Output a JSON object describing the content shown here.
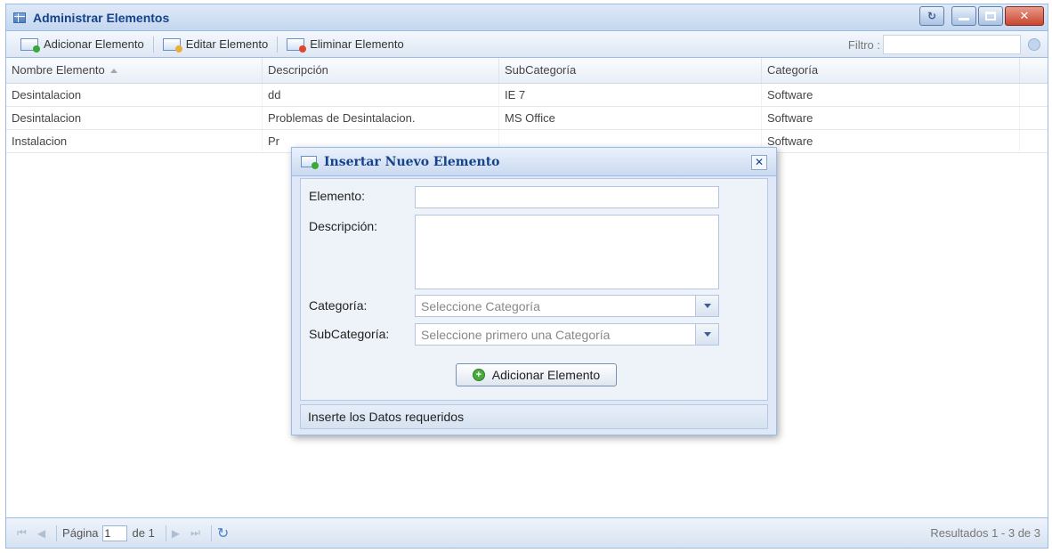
{
  "window": {
    "title": "Administrar Elementos"
  },
  "toolbar": {
    "add_label": "Adicionar Elemento",
    "edit_label": "Editar Elemento",
    "delete_label": "Eliminar Elemento",
    "filter_label": "Filtro :",
    "filter_value": ""
  },
  "grid": {
    "columns": [
      "Nombre Elemento",
      "Descripción",
      "SubCategoría",
      "Categoría"
    ],
    "sort_column": "Nombre Elemento",
    "sort_direction": "ascending",
    "rows": [
      [
        "Desintalacion",
        "dd",
        "IE 7",
        "Software"
      ],
      [
        "Desintalacion",
        "Problemas de Desintalacion.",
        "MS Office",
        "Software"
      ],
      [
        "Instalacion",
        "Pr",
        "",
        "Software"
      ]
    ]
  },
  "paging": {
    "page_label": "Página",
    "page_value": "1",
    "of_label": "de 1",
    "results": "Resultados 1 - 3 de 3"
  },
  "dialog": {
    "title": "Insertar Nuevo Elemento",
    "elemento_label": "Elemento:",
    "elemento_value": "",
    "descripcion_label": "Descripción:",
    "descripcion_value": "",
    "categoria_label": "Categoría:",
    "categoria_placeholder": "Seleccione Categoría",
    "subcategoria_label": "SubCategoría:",
    "subcategoria_placeholder": "Seleccione primero una Categoría",
    "add_button": "Adicionar Elemento",
    "status": "Inserte los Datos requeridos"
  },
  "colors": {
    "border": "#99bbe8",
    "title_text": "#15428b",
    "add_badge": "#3aa836",
    "delete_badge": "#e0462f",
    "edit_badge": "#e8b038"
  }
}
